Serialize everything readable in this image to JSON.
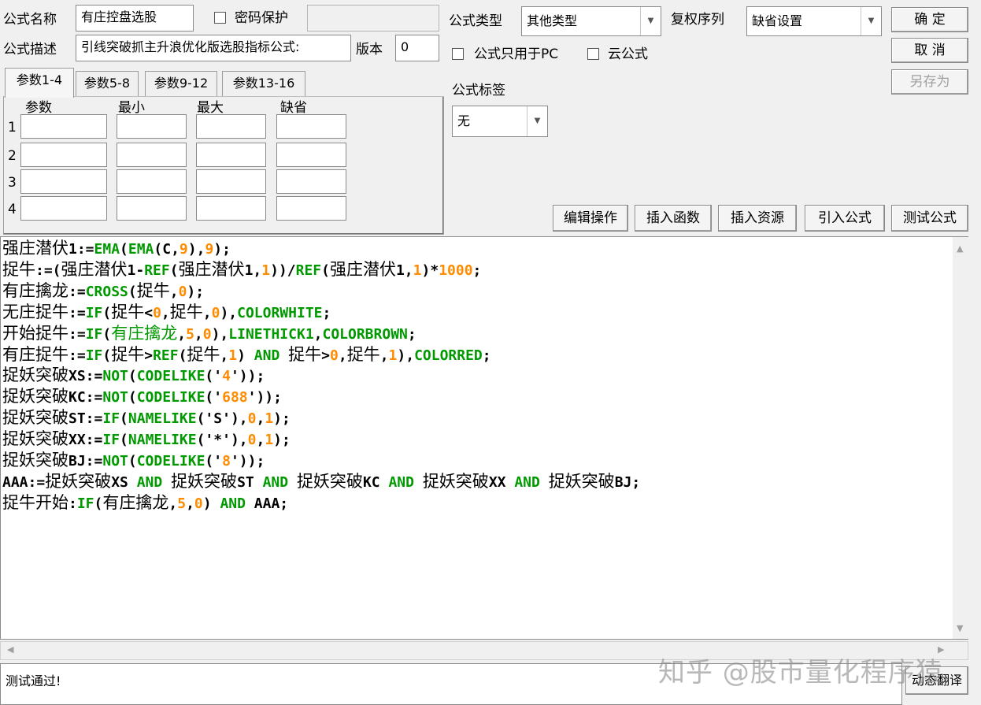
{
  "form": {
    "name_label": "公式名称",
    "name_value": "有庄控盘选股",
    "password_label": "密码保护",
    "password_value": "",
    "desc_label": "公式描述",
    "desc_value": "引线突破抓主升浪优化版选股指标公式:",
    "version_label": "版本",
    "version_value": "0",
    "type_label": "公式类型",
    "type_value": "其他类型",
    "restore_label": "复权序列",
    "restore_value": "缺省设置",
    "pc_only_label": "公式只用于PC",
    "cloud_label": "云公式",
    "tag_label": "公式标签",
    "tag_value": "无"
  },
  "buttons": {
    "ok": "确  定",
    "cancel": "取  消",
    "save_as": "另存为",
    "edit_ops": "编辑操作",
    "insert_func": "插入函数",
    "insert_res": "插入资源",
    "import_formula": "引入公式",
    "test_formula": "测试公式",
    "translate": "动态翻译"
  },
  "tabs": [
    "参数1-4",
    "参数5-8",
    "参数9-12",
    "参数13-16"
  ],
  "params": {
    "headers": [
      "参数",
      "最小",
      "最大",
      "缺省"
    ],
    "rows": [
      "1",
      "2",
      "3",
      "4"
    ]
  },
  "code_lines": [
    [
      {
        "t": "强庄潜伏",
        "c": "cn"
      },
      {
        "t": "1:=",
        "c": ""
      },
      {
        "t": "EMA",
        "c": "fn"
      },
      {
        "t": "(",
        "c": ""
      },
      {
        "t": "EMA",
        "c": "fn"
      },
      {
        "t": "(C,",
        "c": ""
      },
      {
        "t": "9",
        "c": "num"
      },
      {
        "t": "),",
        "c": ""
      },
      {
        "t": "9",
        "c": "num"
      },
      {
        "t": ");",
        "c": ""
      }
    ],
    [
      {
        "t": "捉牛",
        "c": "cn"
      },
      {
        "t": ":=(",
        "c": ""
      },
      {
        "t": "强庄潜伏",
        "c": "cn"
      },
      {
        "t": "1-",
        "c": ""
      },
      {
        "t": "REF",
        "c": "fn"
      },
      {
        "t": "(",
        "c": ""
      },
      {
        "t": "强庄潜伏",
        "c": "cn"
      },
      {
        "t": "1,",
        "c": ""
      },
      {
        "t": "1",
        "c": "num"
      },
      {
        "t": "))/",
        "c": ""
      },
      {
        "t": "REF",
        "c": "fn"
      },
      {
        "t": "(",
        "c": ""
      },
      {
        "t": "强庄潜伏",
        "c": "cn"
      },
      {
        "t": "1,",
        "c": ""
      },
      {
        "t": "1",
        "c": "num"
      },
      {
        "t": ")*",
        "c": ""
      },
      {
        "t": "1000",
        "c": "num"
      },
      {
        "t": ";",
        "c": ""
      }
    ],
    [
      {
        "t": "有庄擒龙",
        "c": "cn"
      },
      {
        "t": ":=",
        "c": ""
      },
      {
        "t": "CROSS",
        "c": "fn"
      },
      {
        "t": "(",
        "c": ""
      },
      {
        "t": "捉牛",
        "c": "cn"
      },
      {
        "t": ",",
        "c": ""
      },
      {
        "t": "0",
        "c": "num"
      },
      {
        "t": ");",
        "c": ""
      }
    ],
    [
      {
        "t": "无庄捉牛",
        "c": "cn"
      },
      {
        "t": ":=",
        "c": ""
      },
      {
        "t": "IF",
        "c": "fn"
      },
      {
        "t": "(",
        "c": ""
      },
      {
        "t": "捉牛",
        "c": "cn"
      },
      {
        "t": "<",
        "c": ""
      },
      {
        "t": "0",
        "c": "num"
      },
      {
        "t": ",",
        "c": ""
      },
      {
        "t": "捉牛",
        "c": "cn"
      },
      {
        "t": ",",
        "c": ""
      },
      {
        "t": "0",
        "c": "num"
      },
      {
        "t": "),",
        "c": ""
      },
      {
        "t": "COLORWHITE",
        "c": "kw"
      },
      {
        "t": ";",
        "c": ""
      }
    ],
    [
      {
        "t": "开始捉牛",
        "c": "cn"
      },
      {
        "t": ":=",
        "c": ""
      },
      {
        "t": "IF",
        "c": "fn"
      },
      {
        "t": "(",
        "c": ""
      },
      {
        "t": "有庄擒龙",
        "c": "cgn"
      },
      {
        "t": ",",
        "c": ""
      },
      {
        "t": "5",
        "c": "num"
      },
      {
        "t": ",",
        "c": ""
      },
      {
        "t": "0",
        "c": "num"
      },
      {
        "t": "),",
        "c": ""
      },
      {
        "t": "LINETHICK1",
        "c": "kw"
      },
      {
        "t": ",",
        "c": ""
      },
      {
        "t": "COLORBROWN",
        "c": "kw"
      },
      {
        "t": ";",
        "c": ""
      }
    ],
    [
      {
        "t": "有庄捉牛",
        "c": "cn"
      },
      {
        "t": ":=",
        "c": ""
      },
      {
        "t": "IF",
        "c": "fn"
      },
      {
        "t": "(",
        "c": ""
      },
      {
        "t": "捉牛",
        "c": "cn"
      },
      {
        "t": ">",
        "c": ""
      },
      {
        "t": "REF",
        "c": "fn"
      },
      {
        "t": "(",
        "c": ""
      },
      {
        "t": "捉牛",
        "c": "cn"
      },
      {
        "t": ",",
        "c": ""
      },
      {
        "t": "1",
        "c": "num"
      },
      {
        "t": ") ",
        "c": ""
      },
      {
        "t": "AND",
        "c": "kw"
      },
      {
        "t": " ",
        "c": ""
      },
      {
        "t": "捉牛",
        "c": "cn"
      },
      {
        "t": ">",
        "c": ""
      },
      {
        "t": "0",
        "c": "num"
      },
      {
        "t": ",",
        "c": ""
      },
      {
        "t": "捉牛",
        "c": "cn"
      },
      {
        "t": ",",
        "c": ""
      },
      {
        "t": "1",
        "c": "num"
      },
      {
        "t": "),",
        "c": ""
      },
      {
        "t": "COLORRED",
        "c": "kw"
      },
      {
        "t": ";",
        "c": ""
      }
    ],
    [
      {
        "t": "捉妖突破",
        "c": "cn"
      },
      {
        "t": "XS:=",
        "c": ""
      },
      {
        "t": "NOT",
        "c": "fn"
      },
      {
        "t": "(",
        "c": ""
      },
      {
        "t": "CODELIKE",
        "c": "fn"
      },
      {
        "t": "('",
        "c": ""
      },
      {
        "t": "4",
        "c": "num"
      },
      {
        "t": "'));",
        "c": ""
      }
    ],
    [
      {
        "t": "捉妖突破",
        "c": "cn"
      },
      {
        "t": "KC:=",
        "c": ""
      },
      {
        "t": "NOT",
        "c": "fn"
      },
      {
        "t": "(",
        "c": ""
      },
      {
        "t": "CODELIKE",
        "c": "fn"
      },
      {
        "t": "('",
        "c": ""
      },
      {
        "t": "688",
        "c": "num"
      },
      {
        "t": "'));",
        "c": ""
      }
    ],
    [
      {
        "t": "捉妖突破",
        "c": "cn"
      },
      {
        "t": "ST:=",
        "c": ""
      },
      {
        "t": "IF",
        "c": "fn"
      },
      {
        "t": "(",
        "c": ""
      },
      {
        "t": "NAMELIKE",
        "c": "fn"
      },
      {
        "t": "('S'),",
        "c": ""
      },
      {
        "t": "0",
        "c": "num"
      },
      {
        "t": ",",
        "c": ""
      },
      {
        "t": "1",
        "c": "num"
      },
      {
        "t": ");",
        "c": ""
      }
    ],
    [
      {
        "t": "捉妖突破",
        "c": "cn"
      },
      {
        "t": "XX:=",
        "c": ""
      },
      {
        "t": "IF",
        "c": "fn"
      },
      {
        "t": "(",
        "c": ""
      },
      {
        "t": "NAMELIKE",
        "c": "fn"
      },
      {
        "t": "('*'),",
        "c": ""
      },
      {
        "t": "0",
        "c": "num"
      },
      {
        "t": ",",
        "c": ""
      },
      {
        "t": "1",
        "c": "num"
      },
      {
        "t": ");",
        "c": ""
      }
    ],
    [
      {
        "t": "捉妖突破",
        "c": "cn"
      },
      {
        "t": "BJ:=",
        "c": ""
      },
      {
        "t": "NOT",
        "c": "fn"
      },
      {
        "t": "(",
        "c": ""
      },
      {
        "t": "CODELIKE",
        "c": "fn"
      },
      {
        "t": "('",
        "c": ""
      },
      {
        "t": "8",
        "c": "num"
      },
      {
        "t": "'));",
        "c": ""
      }
    ],
    [
      {
        "t": "AAA:=",
        "c": ""
      },
      {
        "t": "捉妖突破",
        "c": "cn"
      },
      {
        "t": "XS ",
        "c": ""
      },
      {
        "t": "AND",
        "c": "kw"
      },
      {
        "t": " ",
        "c": ""
      },
      {
        "t": "捉妖突破",
        "c": "cn"
      },
      {
        "t": "ST ",
        "c": ""
      },
      {
        "t": "AND",
        "c": "kw"
      },
      {
        "t": " ",
        "c": ""
      },
      {
        "t": "捉妖突破",
        "c": "cn"
      },
      {
        "t": "KC ",
        "c": ""
      },
      {
        "t": "AND",
        "c": "kw"
      },
      {
        "t": " ",
        "c": ""
      },
      {
        "t": "捉妖突破",
        "c": "cn"
      },
      {
        "t": "XX ",
        "c": ""
      },
      {
        "t": "AND",
        "c": "kw"
      },
      {
        "t": " ",
        "c": ""
      },
      {
        "t": "捉妖突破",
        "c": "cn"
      },
      {
        "t": "BJ;",
        "c": ""
      }
    ],
    [
      {
        "t": "捉牛开始",
        "c": "cn"
      },
      {
        "t": ":",
        "c": ""
      },
      {
        "t": "IF",
        "c": "fn"
      },
      {
        "t": "(",
        "c": ""
      },
      {
        "t": "有庄擒龙",
        "c": "cn"
      },
      {
        "t": ",",
        "c": ""
      },
      {
        "t": "5",
        "c": "num"
      },
      {
        "t": ",",
        "c": ""
      },
      {
        "t": "0",
        "c": "num"
      },
      {
        "t": ") ",
        "c": ""
      },
      {
        "t": "AND",
        "c": "kw"
      },
      {
        "t": " AAA;",
        "c": ""
      }
    ]
  ],
  "status": "测试通过!",
  "watermark": "知乎 @股市量化程序猿",
  "colors": {
    "function": "#009900",
    "number": "#ff8c00",
    "text": "#000000",
    "background": "#f0f0f0"
  }
}
